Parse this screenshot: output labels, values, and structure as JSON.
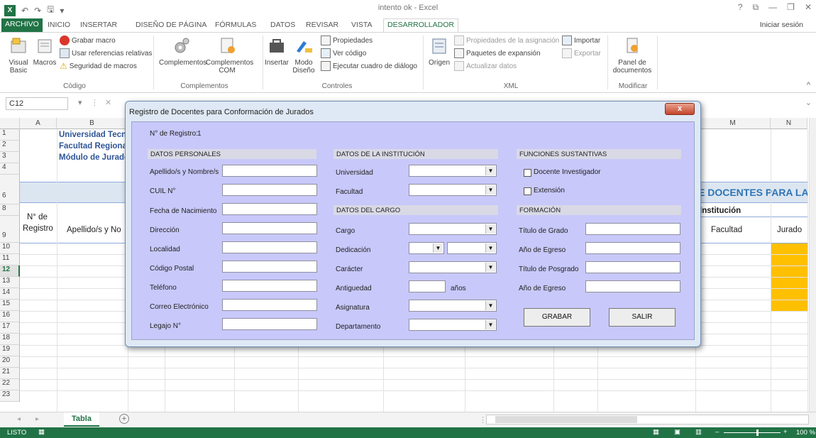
{
  "window": {
    "title": "intento ok - Excel",
    "controls": [
      "?",
      "⧉",
      "—",
      "❐",
      "✕"
    ]
  },
  "ribbon_tabs": [
    "ARCHIVO",
    "INICIO",
    "INSERTAR",
    "DISEÑO DE PÁGINA",
    "FÓRMULAS",
    "DATOS",
    "REVISAR",
    "VISTA",
    "DESARROLLADOR"
  ],
  "active_tab": "DESARROLLADOR",
  "signin": "Iniciar sesión",
  "ribbon": {
    "codigo": {
      "label": "Código",
      "visual_basic": "Visual Basic",
      "macros": "Macros",
      "grabar": "Grabar macro",
      "usar_ref": "Usar referencias relativas",
      "seguridad": "Seguridad de macros"
    },
    "complementos": {
      "label": "Complementos",
      "complementos": "Complementos",
      "complementos_com": "Complementos COM"
    },
    "controles": {
      "label": "Controles",
      "insertar": "Insertar",
      "modo_diseno": "Modo Diseño",
      "propiedades": "Propiedades",
      "ver_codigo": "Ver código",
      "ejecutar": "Ejecutar cuadro de diálogo"
    },
    "xml": {
      "label": "XML",
      "origen": "Origen",
      "propiedades_asig": "Propiedades de la asignación",
      "paquetes": "Paquetes de expansión",
      "actualizar": "Actualizar datos",
      "importar": "Importar",
      "exportar": "Exportar"
    },
    "modificar": {
      "label": "Modificar",
      "panel": "Panel de documentos"
    }
  },
  "formula_bar": {
    "name_box": "C12"
  },
  "columns": [
    "A",
    "B",
    "M",
    "N"
  ],
  "rows": [
    "1",
    "2",
    "3",
    "4",
    "6",
    "8",
    "9",
    "10",
    "11",
    "12",
    "13",
    "14",
    "15",
    "16",
    "17",
    "18",
    "19",
    "20",
    "21",
    "22",
    "23"
  ],
  "cells": {
    "b1": "Universidad Tecno",
    "b2": "Facultad Regional",
    "b3": "Módulo de Jurado",
    "banner": "E DOCENTES PARA LA C",
    "header_nro_1": "N° de",
    "header_nro_2": "Registro",
    "header_apellido": "Apellido/s y No",
    "header_institucion": "Institución",
    "header_facultad": "Facultad",
    "header_jurado": "Jurado"
  },
  "sheet_tab": "Tabla",
  "status": {
    "mode": "LISTO",
    "zoom": "100 %"
  },
  "dialog": {
    "title": "Registro de Docentes para Conformación de Jurados",
    "close": "x",
    "registro_label": "N° de Registro:",
    "registro_value": "1",
    "sections": {
      "personales": "DATOS PERSONALES",
      "institucion": "DATOS DE LA INSTITUCIÓN",
      "cargo": "DATOS DEL CARGO",
      "funciones": "FUNCIONES SUSTANTIVAS",
      "formacion": "FORMACIÓN"
    },
    "personal_fields": [
      "Apellido/s y Nombre/s",
      "CUIL N°",
      "Fecha de Nacimiento",
      "Dirección",
      "Localidad",
      "Código Postal",
      "Teléfono",
      "Correo Electrónico",
      "Legajo N°"
    ],
    "institucion_fields": [
      "Universidad",
      "Facultad"
    ],
    "cargo_fields": [
      "Cargo",
      "Dedicación",
      "Carácter",
      "Antiguedad",
      "Asignatura",
      "Departamento"
    ],
    "antiguedad_unit": "años",
    "funciones": [
      "Docente Investigador",
      "Extensión"
    ],
    "formacion_fields": [
      "Título de Grado",
      "Año de Egreso",
      "Título de Posgrado",
      "Año de Egreso"
    ],
    "buttons": {
      "grabar": "GRABAR",
      "salir": "SALIR"
    }
  }
}
